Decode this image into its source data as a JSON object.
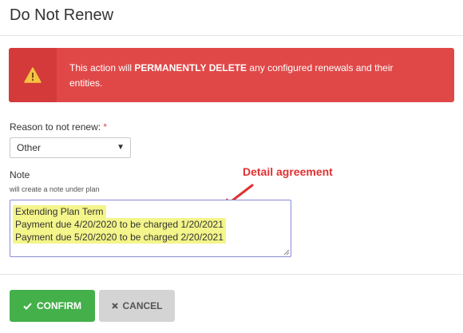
{
  "modal": {
    "title": "Do Not Renew"
  },
  "alert": {
    "icon": "warning-icon",
    "text_prefix": "This action will ",
    "text_bold": "PERMANENTLY DELETE",
    "text_suffix": " any configured renewals and their entities.",
    "color": "#e04848"
  },
  "reason": {
    "label": "Reason to not renew:",
    "required_mark": "*",
    "selected": "Other"
  },
  "note": {
    "label": "Note",
    "sublabel": "will create a note under plan",
    "lines": [
      "Extending Plan Term",
      "Payment due 4/20/2020 to be charged 1/20/2021",
      "Payment due 5/20/2020 to be charged 2/20/2021"
    ]
  },
  "annotation": {
    "text": "Detail agreement",
    "color": "#e03131"
  },
  "buttons": {
    "confirm_label": "CONFIRM",
    "cancel_label": "CANCEL",
    "confirm_color": "#44b04a",
    "cancel_color": "#d4d4d4"
  }
}
